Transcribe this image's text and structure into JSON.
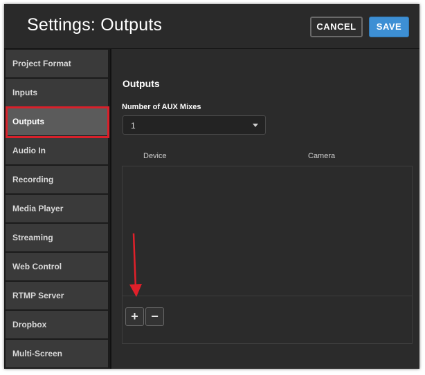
{
  "header": {
    "title": "Settings: Outputs",
    "cancel_label": "CANCEL",
    "save_label": "SAVE"
  },
  "sidebar": {
    "items": [
      {
        "label": "Project Format"
      },
      {
        "label": "Inputs"
      },
      {
        "label": "Outputs",
        "active": true
      },
      {
        "label": "Audio In"
      },
      {
        "label": "Recording"
      },
      {
        "label": "Media Player"
      },
      {
        "label": "Streaming"
      },
      {
        "label": "Web Control"
      },
      {
        "label": "RTMP Server"
      },
      {
        "label": "Dropbox"
      },
      {
        "label": "Multi-Screen"
      }
    ]
  },
  "main": {
    "section_title": "Outputs",
    "aux_label": "Number of AUX Mixes",
    "aux_value": "1",
    "columns": [
      "Device",
      "Camera"
    ],
    "add_label": "+",
    "remove_label": "−"
  },
  "colors": {
    "accent_save": "#3d8fd4",
    "highlight": "#d9202a",
    "annotation_arrow": "#e0202a"
  },
  "icons": {
    "dropdown": "chevron-down-icon",
    "annotation": "red-arrow-icon"
  }
}
